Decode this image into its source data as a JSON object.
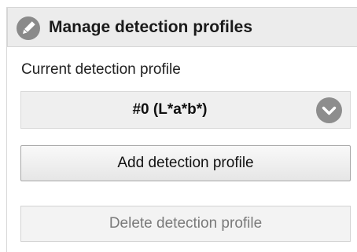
{
  "header": {
    "icon": "pencil-icon",
    "title": "Manage detection profiles"
  },
  "current_profile": {
    "label": "Current detection profile",
    "selected_value": "#0 (L*a*b*)",
    "dropdown_icon": "chevron-down-icon"
  },
  "buttons": {
    "add_label": "Add detection profile",
    "delete_label": "Delete detection profile",
    "delete_enabled": false
  },
  "colors": {
    "header_bg": "#ececec",
    "icon_gray": "#8a8a8a",
    "disabled_text": "#7a7a7a"
  }
}
